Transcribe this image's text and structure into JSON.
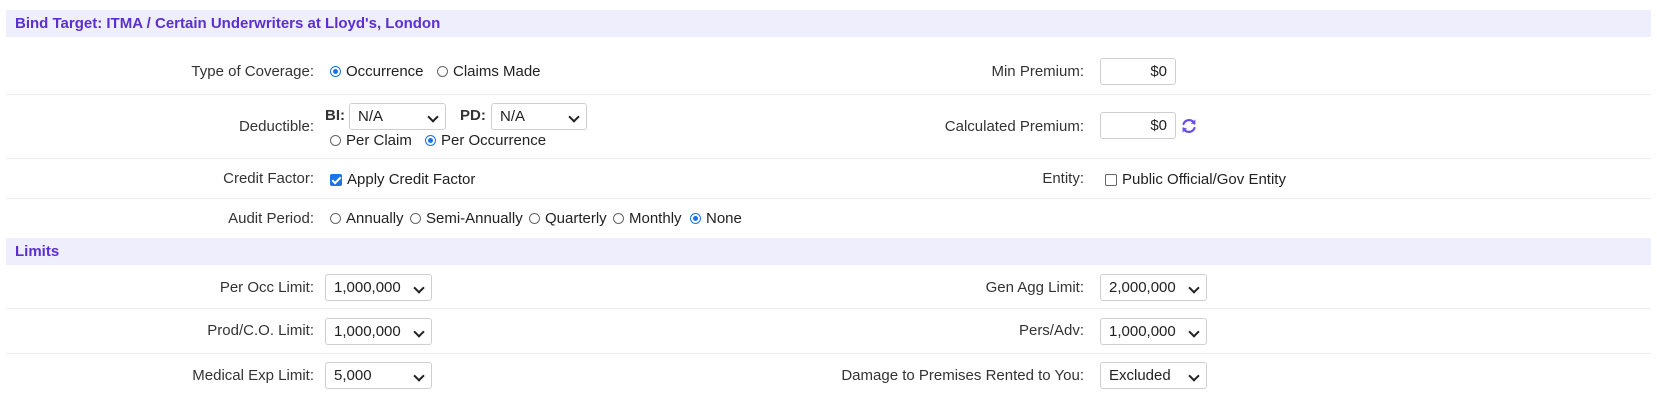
{
  "bind_header": "Bind Target: ITMA / Certain Underwriters at Lloyd's, London",
  "coverage": {
    "label": "Type of Coverage:",
    "options": [
      "Occurrence",
      "Claims Made"
    ],
    "selected": "Occurrence"
  },
  "min_premium": {
    "label": "Min Premium:",
    "value": "$0"
  },
  "deductible": {
    "label": "Deductible:",
    "bi_label": "BI:",
    "bi_value": "N/A",
    "pd_label": "PD:",
    "pd_value": "N/A",
    "basis_options": [
      "Per Claim",
      "Per Occurrence"
    ],
    "basis_selected": "Per Occurrence"
  },
  "calculated_premium": {
    "label": "Calculated Premium:",
    "value": "$0"
  },
  "credit_factor": {
    "label": "Credit Factor:",
    "checkbox_label": "Apply Credit Factor",
    "checked": true
  },
  "entity": {
    "label": "Entity:",
    "checkbox_label": "Public Official/Gov Entity",
    "checked": false
  },
  "audit_period": {
    "label": "Audit Period:",
    "options": [
      "Annually",
      "Semi-Annually",
      "Quarterly",
      "Monthly",
      "None"
    ],
    "selected": "None"
  },
  "limits_header": "Limits",
  "limits": {
    "per_occ": {
      "label": "Per Occ Limit:",
      "value": "1,000,000"
    },
    "gen_agg": {
      "label": "Gen Agg Limit:",
      "value": "2,000,000"
    },
    "prod_co": {
      "label": "Prod/C.O. Limit:",
      "value": "1,000,000"
    },
    "pers_adv": {
      "label": "Pers/Adv:",
      "value": "1,000,000"
    },
    "medical": {
      "label": "Medical Exp Limit:",
      "value": "5,000"
    },
    "premises": {
      "label": "Damage to Premises Rented to You:",
      "value": "Excluded"
    }
  },
  "colors": {
    "accent": "#5b2fd0",
    "header_bg": "#eeeefc",
    "control_blue": "#1a73e8"
  },
  "icons": {
    "refresh": "refresh-icon"
  }
}
